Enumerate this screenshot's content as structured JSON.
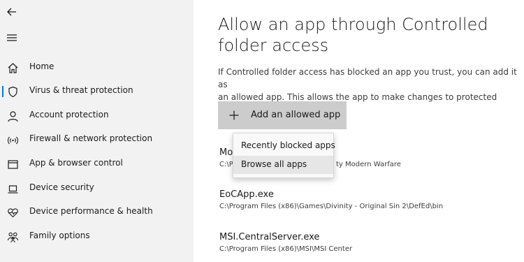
{
  "header": {
    "back_icon": "back-arrow-icon",
    "menu_icon": "hamburger-menu-icon"
  },
  "sidebar": {
    "items": [
      {
        "label": "Home",
        "icon": "home-icon"
      },
      {
        "label": "Virus & threat protection",
        "icon": "shield-icon",
        "active": true
      },
      {
        "label": "Account protection",
        "icon": "person-icon"
      },
      {
        "label": "Firewall & network protection",
        "icon": "wifi-icon"
      },
      {
        "label": "App & browser control",
        "icon": "browser-window-icon"
      },
      {
        "label": "Device security",
        "icon": "laptop-icon"
      },
      {
        "label": "Device performance & health",
        "icon": "heart-pulse-icon"
      },
      {
        "label": "Family options",
        "icon": "family-icon"
      }
    ],
    "accent_color": "#0078d4"
  },
  "main": {
    "title": "Allow an app through Controlled folder access",
    "description": "If Controlled folder access has blocked an app you trust, you can add it as\nan allowed app. This allows the app to make changes to protected folders.",
    "add_button_label": "Add an allowed app",
    "apps": [
      {
        "name": "Mo",
        "path": "C:\\P"
      },
      {
        "name": "EoCApp.exe",
        "path": "C:\\Program Files (x86)\\Games\\Divinity - Original Sin 2\\DefEd\\bin"
      },
      {
        "name": "MSI.CentralServer.exe",
        "path": "C:\\Program Files (x86)\\MSI\\MSI Center"
      }
    ],
    "app0_path_tail": "ty Modern Warfare"
  },
  "dropdown": {
    "items": [
      {
        "label": "Recently blocked apps"
      },
      {
        "label": "Browse all apps",
        "hovered": true
      }
    ]
  }
}
